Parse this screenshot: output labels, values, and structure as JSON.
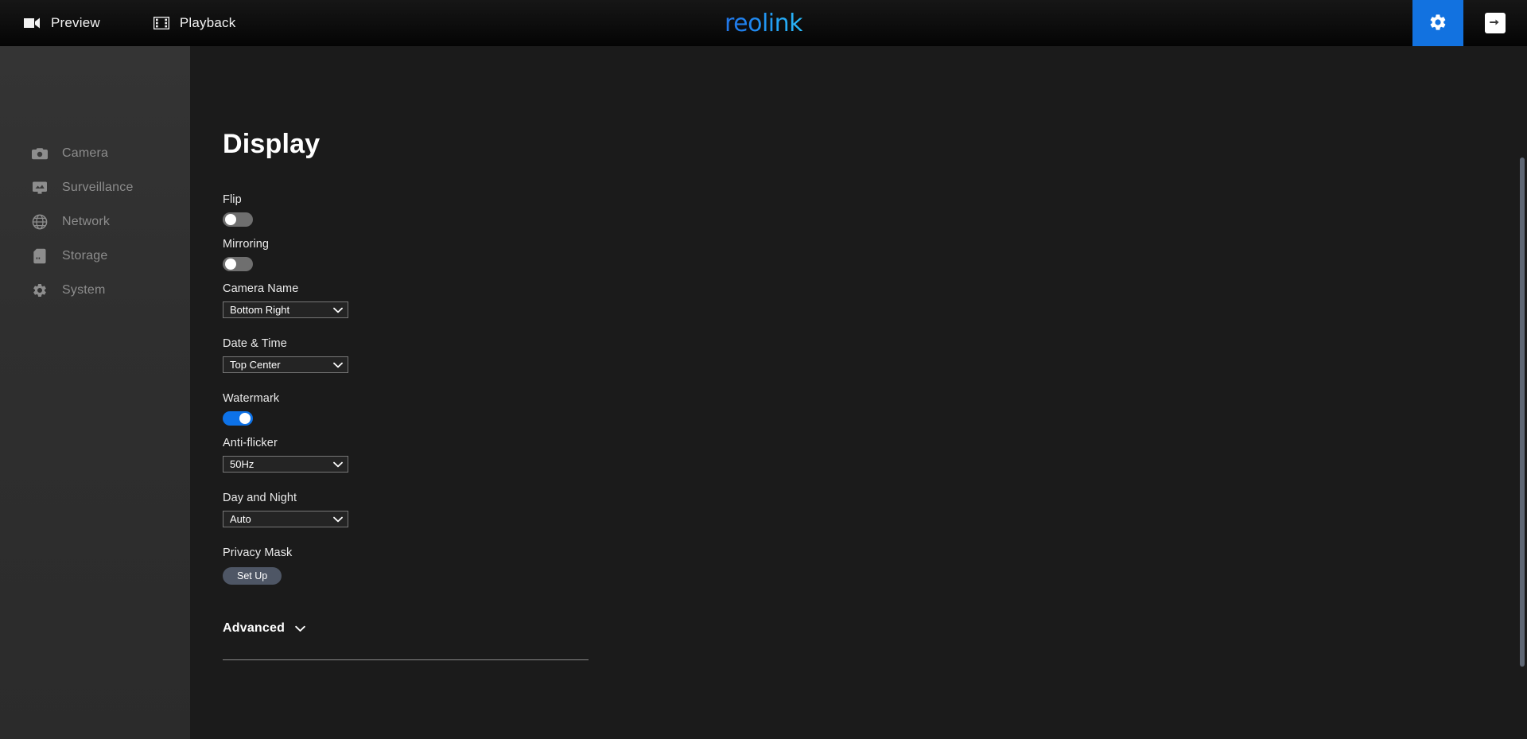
{
  "header": {
    "tabs": [
      {
        "label": "Preview",
        "icon": "video-camera-icon"
      },
      {
        "label": "Playback",
        "icon": "film-strip-icon"
      }
    ],
    "logo": "reolink",
    "settings_icon": "gear-icon",
    "logout_icon": "exit-arrow-icon",
    "accent_color": "#1272e0"
  },
  "sidebar": {
    "items": [
      {
        "label": "Camera",
        "icon": "camera-icon"
      },
      {
        "label": "Surveillance",
        "icon": "monitor-icon"
      },
      {
        "label": "Network",
        "icon": "globe-icon"
      },
      {
        "label": "Storage",
        "icon": "sd-card-icon"
      },
      {
        "label": "System",
        "icon": "gear-icon"
      }
    ]
  },
  "main": {
    "title": "Display",
    "fields": {
      "flip": {
        "label": "Flip",
        "value": "off"
      },
      "mirroring": {
        "label": "Mirroring",
        "value": "off"
      },
      "camera_name": {
        "label": "Camera Name",
        "value": "Bottom Right"
      },
      "date_time": {
        "label": "Date & Time",
        "value": "Top Center"
      },
      "watermark": {
        "label": "Watermark",
        "value": "on"
      },
      "anti_flicker": {
        "label": "Anti-flicker",
        "value": "50Hz"
      },
      "day_and_night": {
        "label": "Day and Night",
        "value": "Auto"
      },
      "privacy_mask": {
        "label": "Privacy Mask",
        "button_label": "Set Up"
      }
    },
    "advanced": {
      "label": "Advanced",
      "icon": "chevron-down-icon"
    }
  },
  "colors": {
    "accent": "#1272e0",
    "toggle_on": "#0d72e8",
    "toggle_off": "#6f6f6f",
    "page_bg": "#1b1b1b",
    "sidebar_bg": "#2f2f2f",
    "header_bg": "#0d0d0d",
    "setup_button": "#4e5665"
  }
}
